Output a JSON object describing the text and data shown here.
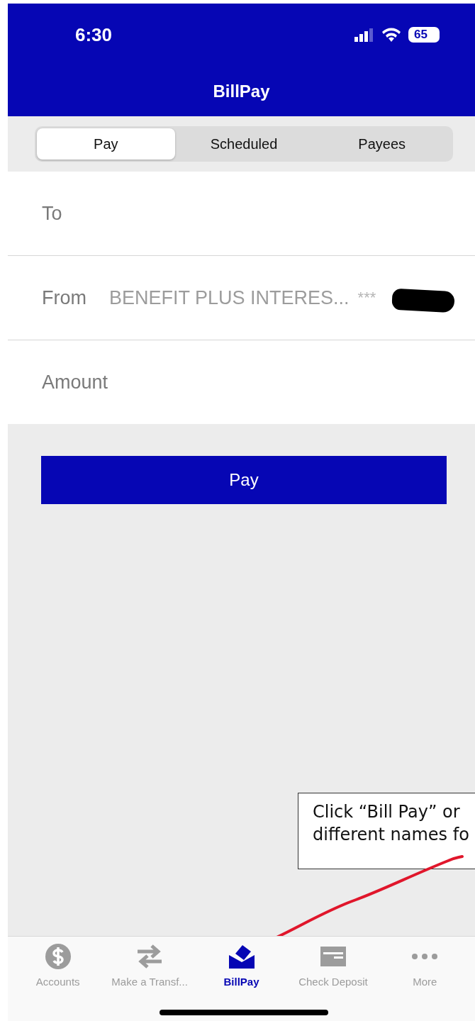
{
  "status_bar": {
    "time": "6:30",
    "battery": "65"
  },
  "header": {
    "title": "BillPay"
  },
  "segments": [
    {
      "label": "Pay",
      "selected": true
    },
    {
      "label": "Scheduled",
      "selected": false
    },
    {
      "label": "Payees",
      "selected": false
    }
  ],
  "form": {
    "rows": [
      {
        "label": "To"
      },
      {
        "label": "From",
        "value": "BENEFIT PLUS INTERES...",
        "masked": "***"
      },
      {
        "label": "Amount"
      }
    ]
  },
  "pay_button": "Pay",
  "annotation": {
    "lines": [
      "Click “Bill Pay” or",
      "different names fo"
    ]
  },
  "tab_bar": [
    {
      "label": "Accounts",
      "selected": false
    },
    {
      "label": "Make a Transf...",
      "selected": false
    },
    {
      "label": "BillPay",
      "selected": true
    },
    {
      "label": "Check Deposit",
      "selected": false
    },
    {
      "label": "More",
      "selected": false
    }
  ]
}
